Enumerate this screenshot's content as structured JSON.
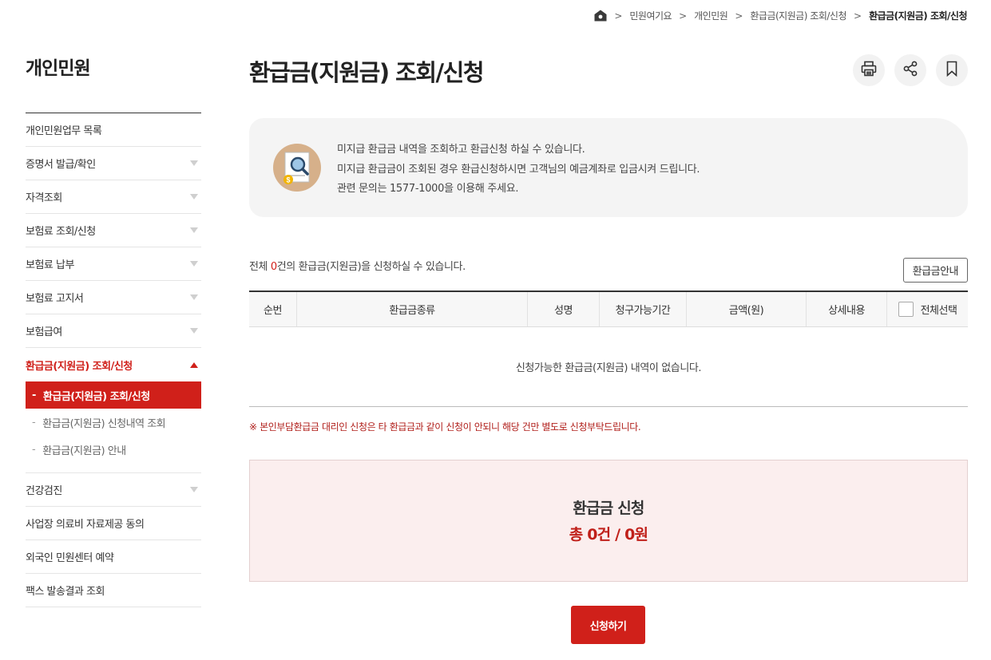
{
  "breadcrumb": {
    "items": [
      "민원여기요",
      "개인민원",
      "환급금(지원금) 조회/신청",
      "환급금(지원금) 조회/신청"
    ]
  },
  "sidebar": {
    "title": "개인민원",
    "items": [
      {
        "label": "개인민원업무 목록"
      },
      {
        "label": "증명서 발급/확인"
      },
      {
        "label": "자격조회"
      },
      {
        "label": "보험료 조회/신청"
      },
      {
        "label": "보험료 납부"
      },
      {
        "label": "보험료 고지서"
      },
      {
        "label": "보험급여"
      },
      {
        "label": "환급금(지원금) 조회/신청"
      },
      {
        "label": "건강검진"
      },
      {
        "label": "사업장 의료비 자료제공 동의"
      },
      {
        "label": "외국인 민원센터 예약"
      },
      {
        "label": "팩스 발송결과 조회"
      }
    ],
    "submenu": [
      {
        "label": "환급금(지원금) 조회/신청"
      },
      {
        "label": "환급금(지원금) 신청내역 조회"
      },
      {
        "label": "환급금(지원금) 안내"
      }
    ],
    "dash": "-"
  },
  "main": {
    "title": "환급금(지원금) 조회/신청",
    "info": [
      "미지급 환급금 내역을 조회하고 환급신청 하실 수 있습니다.",
      "미지급 환급금이 조회된 경우 환급신청하시면 고객님의 예금계좌로 입금시켜 드립니다.",
      "관련 문의는 1577-1000을 이용해 주세요."
    ],
    "count": {
      "prefix": "전체 ",
      "num": "0",
      "suffix": "건의 환급금(지원금)을 신청하실 수 있습니다."
    },
    "guide_button": "환급금안내",
    "table": {
      "headers": [
        "순번",
        "환급금종류",
        "성명",
        "청구가능기간",
        "금액(원)",
        "상세내용",
        "전체선택"
      ],
      "empty": "신청가능한 환급금(지원금) 내역이 없습니다."
    },
    "notice": "※ 본인부담환급금 대리인 신청은 타 환급금과 같이 신청이 안되니 해당 건만 별도로 신청부탁드립니다.",
    "summary": {
      "title": "환급금 신청",
      "total": "총 0건 / 0원"
    },
    "apply_button": "신청하기"
  },
  "colors": {
    "accent": "#d0201a",
    "summary_bg": "#fbeeee",
    "info_bg": "#f4f4f4"
  },
  "icons": [
    "home-icon",
    "print-icon",
    "share-icon",
    "bookmark-icon",
    "refund-search-icon"
  ]
}
